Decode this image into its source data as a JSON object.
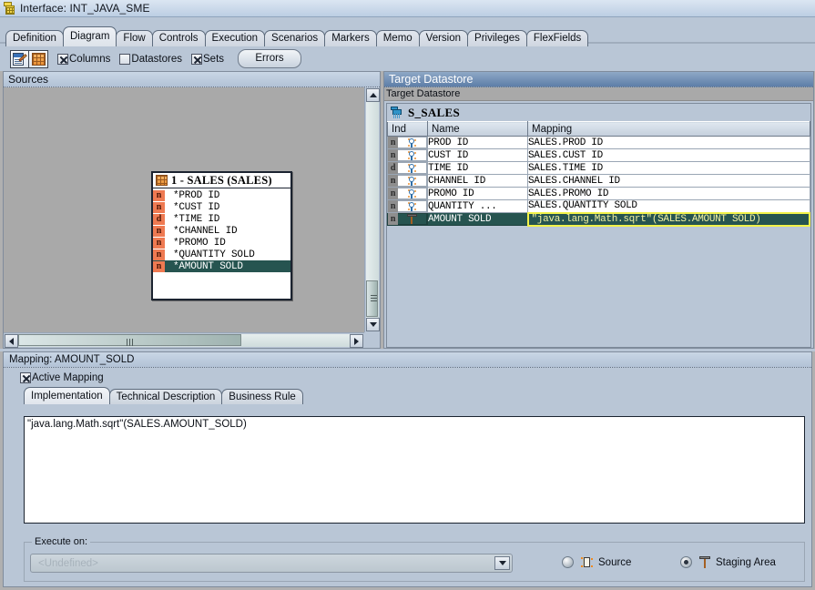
{
  "window": {
    "title": "Interface: INT_JAVA_SME",
    "icon": "interface-icon"
  },
  "tabs": [
    {
      "label": "Definition",
      "selected": false
    },
    {
      "label": "Diagram",
      "selected": true
    },
    {
      "label": "Flow",
      "selected": false
    },
    {
      "label": "Controls",
      "selected": false
    },
    {
      "label": "Execution",
      "selected": false
    },
    {
      "label": "Scenarios",
      "selected": false
    },
    {
      "label": "Markers",
      "selected": false
    },
    {
      "label": "Memo",
      "selected": false
    },
    {
      "label": "Version",
      "selected": false
    },
    {
      "label": "Privileges",
      "selected": false
    },
    {
      "label": "FlexFields",
      "selected": false
    }
  ],
  "toolbar": {
    "buttons": [
      {
        "name": "edit-icon"
      },
      {
        "name": "grid-icon"
      }
    ],
    "checkboxes": [
      {
        "label": "Columns",
        "checked": true
      },
      {
        "label": "Datastores",
        "checked": false
      },
      {
        "label": "Sets",
        "checked": true
      }
    ],
    "errors_button": "Errors"
  },
  "sources_pane": {
    "title": "Sources",
    "datastore": {
      "header": "1 - SALES  (SALES)",
      "columns": [
        {
          "ind": "n",
          "name": "*PROD ID",
          "selected": false
        },
        {
          "ind": "n",
          "name": "*CUST ID",
          "selected": false
        },
        {
          "ind": "d",
          "name": "*TIME ID",
          "selected": false
        },
        {
          "ind": "n",
          "name": "*CHANNEL ID",
          "selected": false
        },
        {
          "ind": "n",
          "name": "*PROMO ID",
          "selected": false
        },
        {
          "ind": "n",
          "name": "*QUANTITY SOLD",
          "selected": false
        },
        {
          "ind": "n",
          "name": "*AMOUNT SOLD",
          "selected": true
        }
      ]
    }
  },
  "target_pane": {
    "title": "Target Datastore",
    "subtitle": "Target Datastore",
    "datastore_name": "S_SALES",
    "columns": [
      "Ind",
      "Name",
      "Mapping"
    ],
    "rows": [
      {
        "ind": "n",
        "icon": "key-icon",
        "name": "PROD ID",
        "mapping": "SALES.PROD ID",
        "selected": false
      },
      {
        "ind": "n",
        "icon": "key-icon",
        "name": "CUST ID",
        "mapping": "SALES.CUST ID",
        "selected": false
      },
      {
        "ind": "d",
        "icon": "key-icon",
        "name": "TIME ID",
        "mapping": "SALES.TIME ID",
        "selected": false
      },
      {
        "ind": "n",
        "icon": "key-icon",
        "name": "CHANNEL ID",
        "mapping": "SALES.CHANNEL ID",
        "selected": false
      },
      {
        "ind": "n",
        "icon": "key-icon",
        "name": "PROMO ID",
        "mapping": "SALES.PROMO ID",
        "selected": false
      },
      {
        "ind": "n",
        "icon": "key-icon",
        "name": "QUANTITY ...",
        "mapping": "SALES.QUANTITY SOLD",
        "selected": false
      },
      {
        "ind": "n",
        "icon": "hammer-icon",
        "name": "AMOUNT SOLD",
        "mapping": "\"java.lang.Math.sqrt\"(SALES.AMOUNT SOLD)",
        "selected": true
      }
    ]
  },
  "mapping_panel": {
    "title": "Mapping: AMOUNT_SOLD",
    "active_mapping_label": "Active Mapping",
    "active_mapping_checked": true,
    "tabs": [
      {
        "label": "Implementation",
        "selected": true
      },
      {
        "label": "Technical Description",
        "selected": false
      },
      {
        "label": "Business Rule",
        "selected": false
      }
    ],
    "implementation_text": "\"java.lang.Math.sqrt\"(SALES.AMOUNT_SOLD)",
    "execute_on": {
      "group_label": "Execute on:",
      "combo_value": "<Undefined>",
      "options": [
        {
          "label": "Source",
          "icon": "source-icon",
          "selected": false
        },
        {
          "label": "Staging Area",
          "icon": "staging-icon",
          "selected": true
        }
      ]
    }
  },
  "colors": {
    "selection": "#265450",
    "edit_border": "#f2f24a",
    "panel": "#b9c6d6",
    "canvas": "#a9a9a9"
  }
}
